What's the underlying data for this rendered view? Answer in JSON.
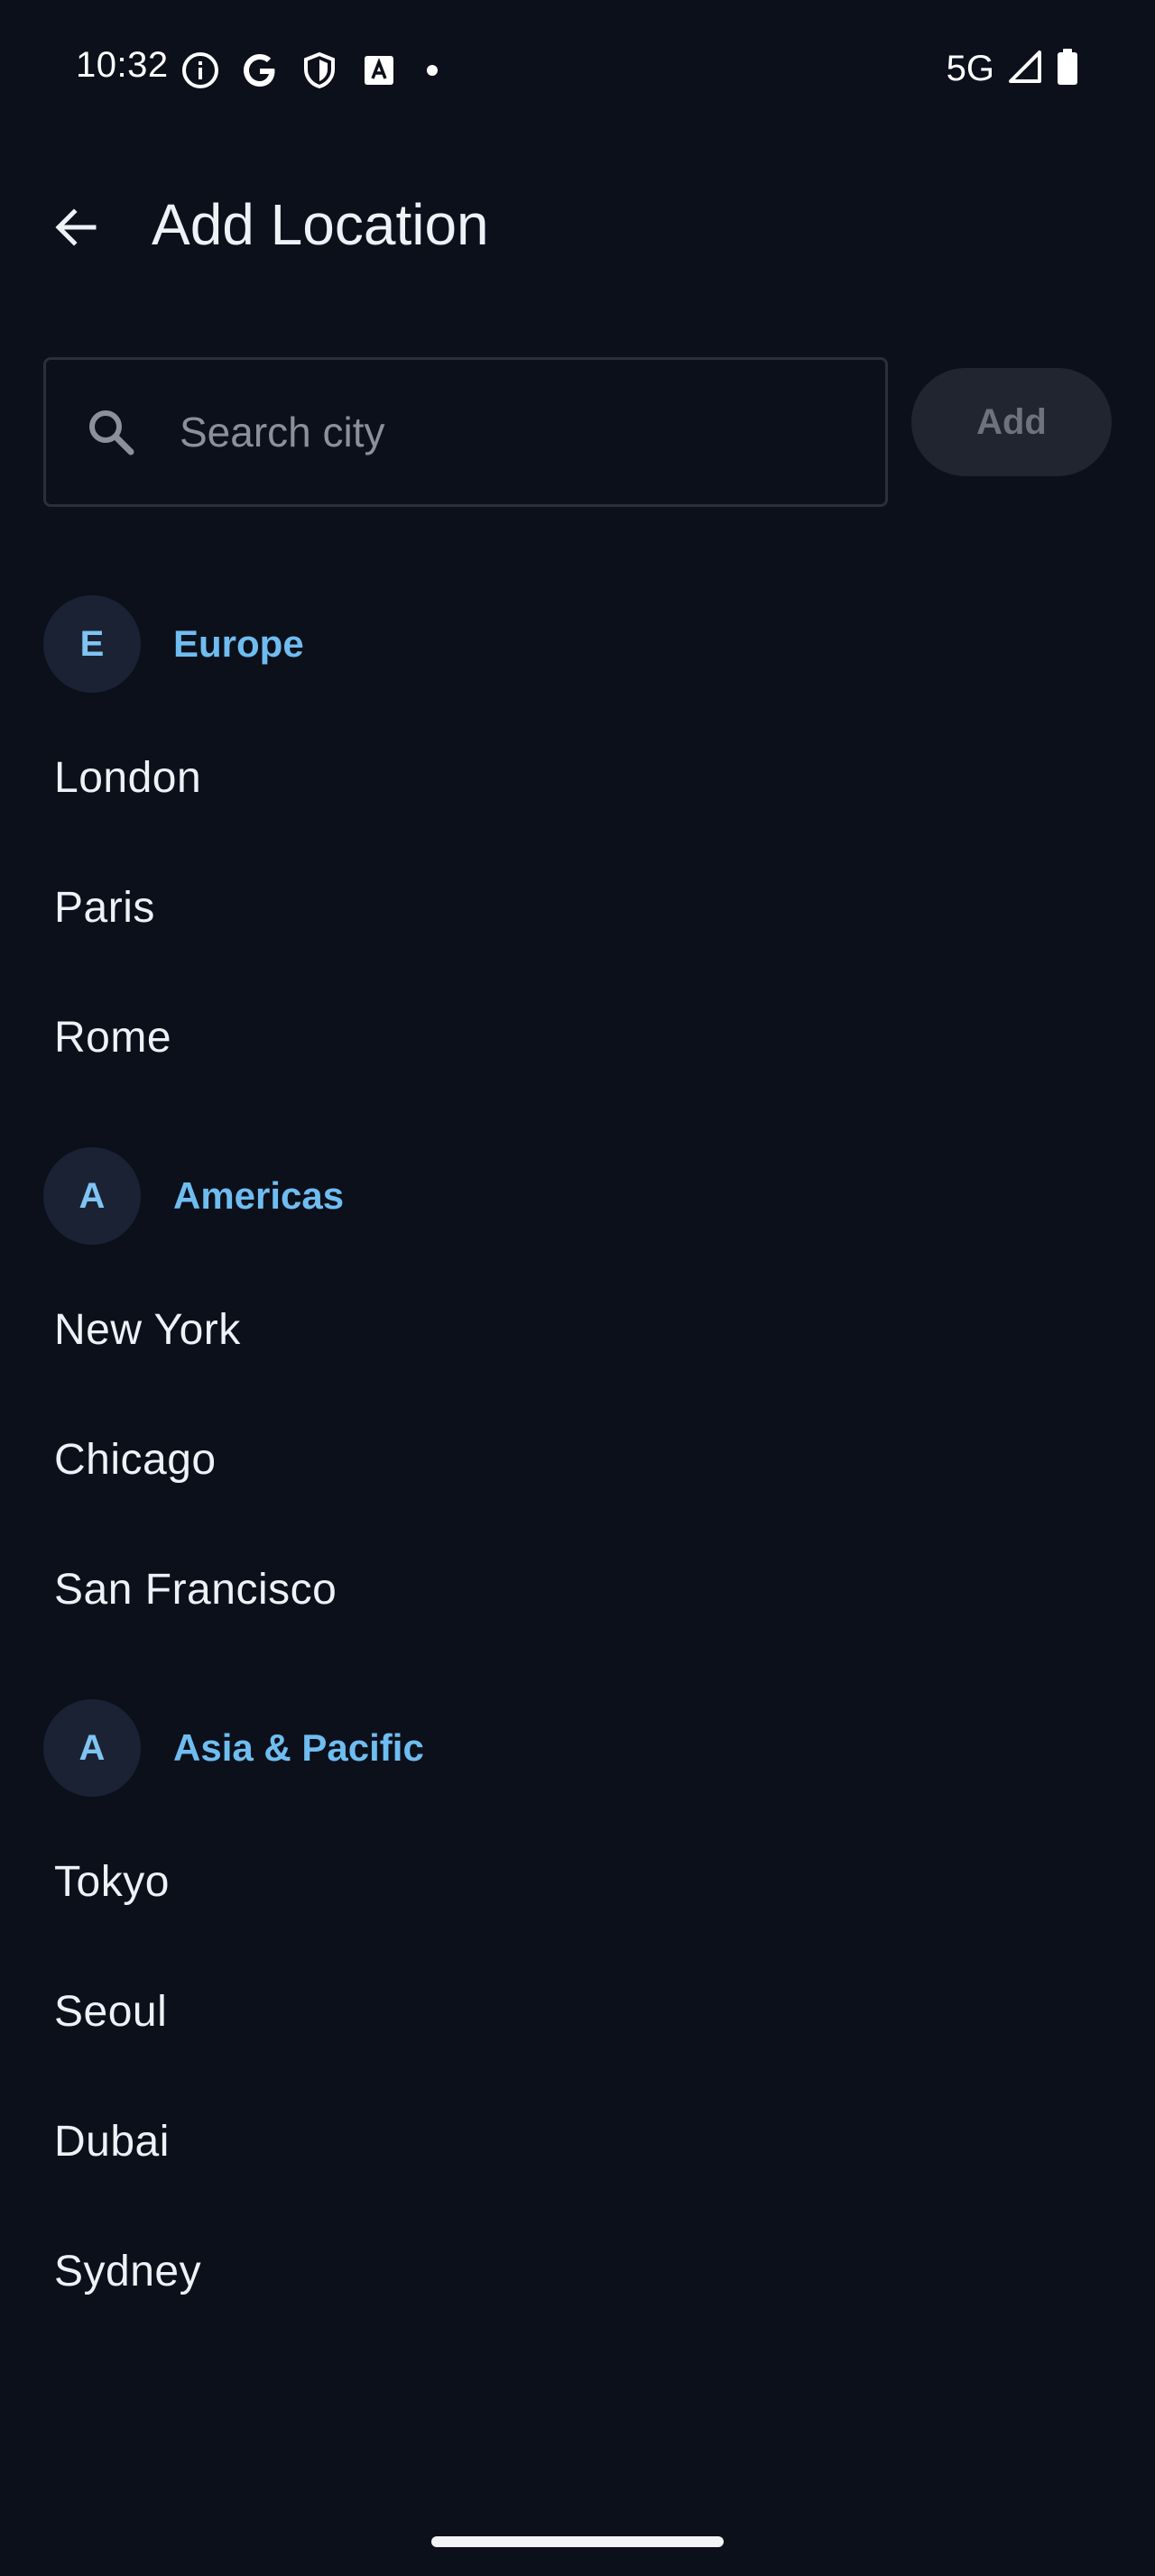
{
  "status_bar": {
    "time": "10:32",
    "network": "5G",
    "left_icons": [
      "info-icon",
      "google-icon",
      "shield-icon",
      "font-icon",
      "dot-icon"
    ],
    "right_icons": [
      "signal-icon",
      "battery-icon"
    ]
  },
  "app_bar": {
    "title": "Add Location",
    "back_icon": "arrow-back-icon"
  },
  "search": {
    "placeholder": "Search city",
    "value": "",
    "icon": "search-icon"
  },
  "add_button": {
    "label": "Add",
    "enabled": false
  },
  "sections": [
    {
      "initial": "E",
      "title": "Europe",
      "cities": [
        "London",
        "Paris",
        "Rome"
      ]
    },
    {
      "initial": "A",
      "title": "Americas",
      "cities": [
        "New York",
        "Chicago",
        "San Francisco"
      ]
    },
    {
      "initial": "A",
      "title": "Asia & Pacific",
      "cities": [
        "Tokyo",
        "Seoul",
        "Dubai",
        "Sydney"
      ]
    }
  ],
  "colors": {
    "background": "#0c101b",
    "section_accent": "#6fbdf0",
    "avatar_bg": "#1b2233",
    "button_disabled_bg": "#21252f",
    "button_disabled_text": "#6d727d"
  }
}
